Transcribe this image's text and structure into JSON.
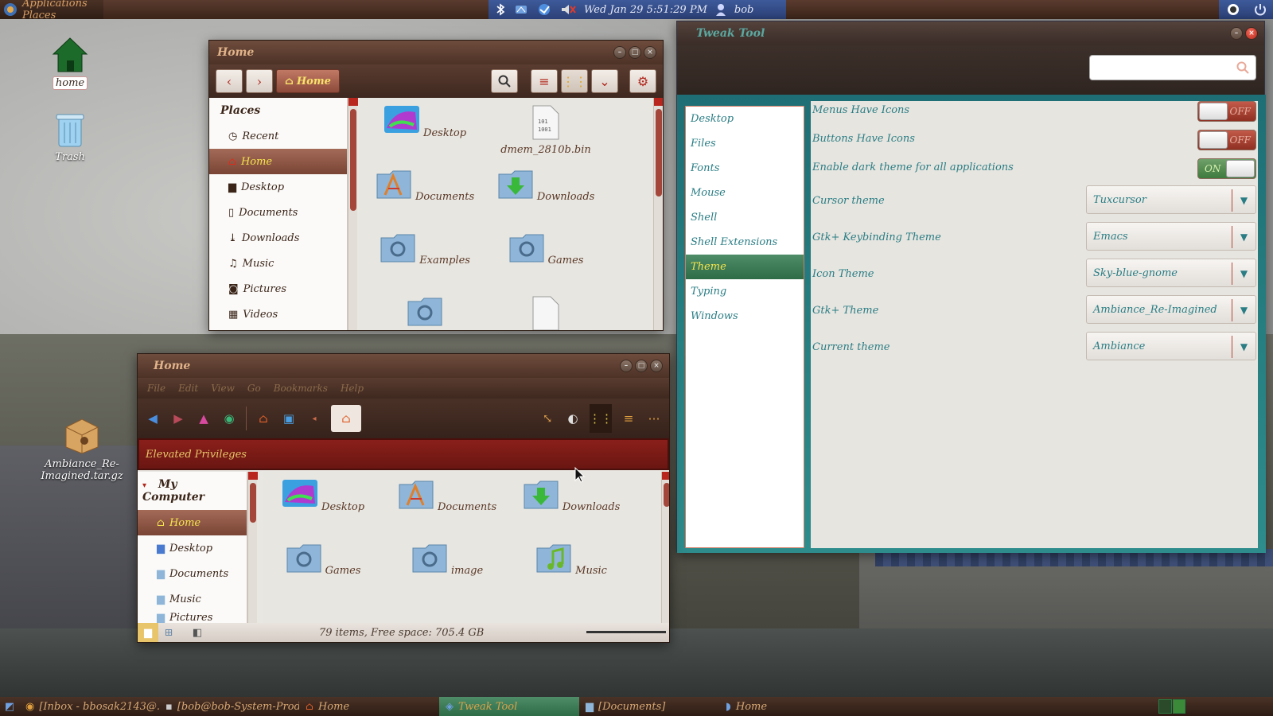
{
  "top_panel": {
    "app_menu": "Applications Places",
    "clock": "Wed Jan 29   5:51:29 PM",
    "user": "bob"
  },
  "desktop": {
    "icons": [
      {
        "label": "home",
        "icon": "home-icon"
      },
      {
        "label": "Trash",
        "icon": "trash-icon"
      },
      {
        "label": "Ambiance_Re-Imagined.tar.gz",
        "icon": "archive-icon"
      }
    ]
  },
  "nautilus": {
    "title": "Home",
    "path_button": "Home",
    "sidebar_header": "Places",
    "sidebar_items": [
      "Recent",
      "Home",
      "Desktop",
      "Documents",
      "Downloads",
      "Music",
      "Pictures",
      "Videos"
    ],
    "files": [
      "Desktop",
      "dmem_2810b.bin",
      "Documents",
      "Downloads",
      "Examples",
      "Games"
    ]
  },
  "tweak_tool": {
    "title": "Tweak Tool",
    "search_placeholder": "",
    "categories": [
      "Desktop",
      "Files",
      "Fonts",
      "Mouse",
      "Shell",
      "Shell Extensions",
      "Theme",
      "Typing",
      "Windows"
    ],
    "settings": {
      "menus_have_icons": {
        "label": "Menus Have Icons",
        "state": "OFF"
      },
      "buttons_have_icons": {
        "label": "Buttons Have Icons",
        "state": "OFF"
      },
      "dark_theme": {
        "label": "Enable dark theme for all applications",
        "state": "ON"
      },
      "cursor_theme": {
        "label": "Cursor theme",
        "value": "Tuxcursor"
      },
      "keybinding_theme": {
        "label": "Gtk+ Keybinding Theme",
        "value": "Emacs"
      },
      "icon_theme": {
        "label": "Icon Theme",
        "value": "Sky-blue-gnome"
      },
      "gtk_theme": {
        "label": "Gtk+ Theme",
        "value": "Ambiance_Re-Imagined"
      },
      "current_theme": {
        "label": "Current theme",
        "value": "Ambiance"
      }
    }
  },
  "caja": {
    "title": "Home",
    "menus": [
      "File",
      "Edit",
      "View",
      "Go",
      "Bookmarks",
      "Help"
    ],
    "elevated_banner": "Elevated Privileges",
    "sidebar_header": "My Computer",
    "sidebar_items": [
      "Home",
      "Desktop",
      "Documents",
      "Music",
      "Pictures"
    ],
    "files": [
      "Desktop",
      "Documents",
      "Downloads",
      "Games",
      "image",
      "Music"
    ],
    "status": "79 items, Free space: 705.4 GB"
  },
  "taskbar": {
    "tasks": [
      {
        "label": "[Inbox - bbosak2143@...",
        "active": false
      },
      {
        "label": "[bob@bob-System-Prod...",
        "active": false
      },
      {
        "label": "Home",
        "active": false
      },
      {
        "label": "Tweak Tool",
        "active": true
      },
      {
        "label": "[Documents]",
        "active": false
      },
      {
        "label": "Home",
        "active": false
      }
    ]
  },
  "colors": {
    "accent_red": "#b0261b",
    "accent_yellow": "#f5e44c",
    "teal": "#2a7d84",
    "titlebar_brown": "#4d3226"
  }
}
